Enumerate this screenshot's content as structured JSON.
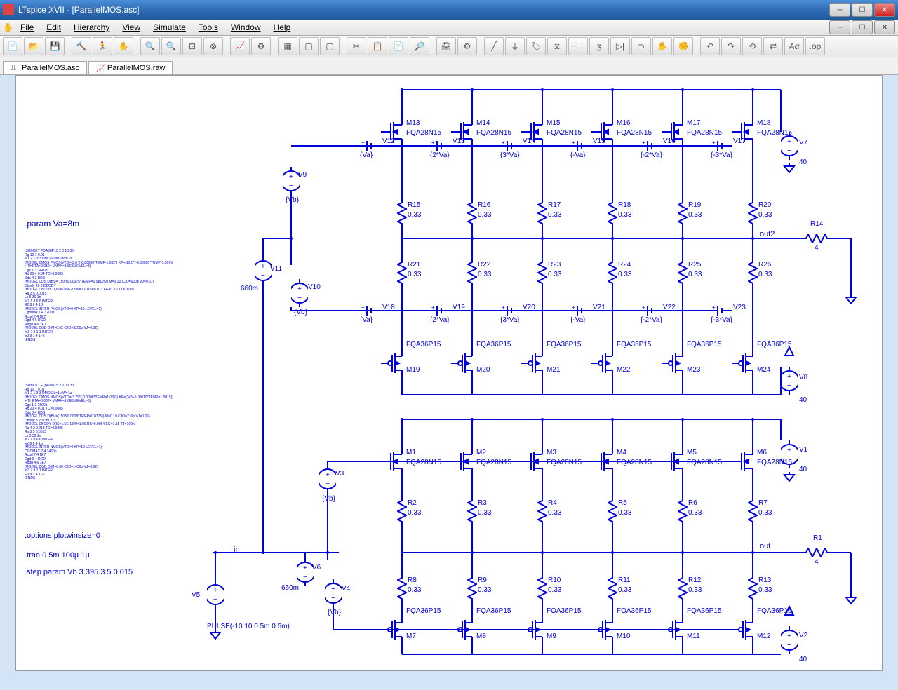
{
  "app_title": "LTspice XVII - [ParallelMOS.asc]",
  "menus": [
    "File",
    "Edit",
    "Hierarchy",
    "View",
    "Simulate",
    "Tools",
    "Window",
    "Help"
  ],
  "tabs": [
    "ParallelMOS.asc",
    "ParallelMOS.raw"
  ],
  "param_line": ".param Va=8m",
  "options_line": ".options plotwinsize=0",
  "tran_line": ".tran 0 5m 100µ 1µ",
  "step_line": ".step param Vb 3.395 3.5 0.015",
  "pulse_line": "PULSE(-10 10 0 5m 0 5m)",
  "in_label": "in",
  "out_label": "out",
  "out2_label": "out2",
  "components": {
    "V1": {
      "label": "V1",
      "value": "40"
    },
    "V2": {
      "label": "V2",
      "value": "40"
    },
    "V3": {
      "label": "V3",
      "value": "{Vb}"
    },
    "V4": {
      "label": "V4",
      "value": "{Vb}"
    },
    "V5": {
      "label": "V5",
      "value": ""
    },
    "V6": {
      "label": "V6",
      "value": "660m"
    },
    "V7": {
      "label": "V7",
      "value": "40"
    },
    "V8": {
      "label": "V8",
      "value": "40"
    },
    "V9": {
      "label": "V9",
      "value": "{Vb}"
    },
    "V10": {
      "label": "V10",
      "value": "{Vb}"
    },
    "V11": {
      "label": "V11",
      "value": "660m"
    },
    "V12": {
      "label": "V12",
      "value": "{Va}"
    },
    "V13": {
      "label": "V13",
      "value": "{2*Va}"
    },
    "V14": {
      "label": "V14",
      "value": "{3*Va}"
    },
    "V15": {
      "label": "V15",
      "value": "{-Va}"
    },
    "V16": {
      "label": "V16",
      "value": "{-2*Va}"
    },
    "V17": {
      "label": "V17",
      "value": "{-3*Va}"
    },
    "V18": {
      "label": "V18",
      "value": "{Va}"
    },
    "V19": {
      "label": "V19",
      "value": "{2*Va}"
    },
    "V20": {
      "label": "V20",
      "value": "{3*Va}"
    },
    "V21": {
      "label": "V21",
      "value": "{-Va}"
    },
    "V22": {
      "label": "V22",
      "value": "{-2*Va}"
    },
    "V23": {
      "label": "V23",
      "value": "{-3*Va}"
    },
    "R1": {
      "label": "R1",
      "value": "4"
    },
    "R2": {
      "label": "R2",
      "value": "0.33"
    },
    "R3": {
      "label": "R3",
      "value": "0.33"
    },
    "R4": {
      "label": "R4",
      "value": "0.33"
    },
    "R5": {
      "label": "R5",
      "value": "0.33"
    },
    "R6": {
      "label": "R6",
      "value": "0.33"
    },
    "R7": {
      "label": "R7",
      "value": "0.33"
    },
    "R8": {
      "label": "R8",
      "value": "0.33"
    },
    "R9": {
      "label": "R9",
      "value": "0.33"
    },
    "R10": {
      "label": "R10",
      "value": "0.33"
    },
    "R11": {
      "label": "R11",
      "value": "0.33"
    },
    "R12": {
      "label": "R12",
      "value": "0.33"
    },
    "R13": {
      "label": "R13",
      "value": "0.33"
    },
    "R14": {
      "label": "R14",
      "value": "4"
    },
    "R15": {
      "label": "R15",
      "value": "0.33"
    },
    "R16": {
      "label": "R16",
      "value": "0.33"
    },
    "R17": {
      "label": "R17",
      "value": "0.33"
    },
    "R18": {
      "label": "R18",
      "value": "0.33"
    },
    "R19": {
      "label": "R19",
      "value": "0.33"
    },
    "R20": {
      "label": "R20",
      "value": "0.33"
    },
    "R21": {
      "label": "R21",
      "value": "0.33"
    },
    "R22": {
      "label": "R22",
      "value": "0.33"
    },
    "R23": {
      "label": "R23",
      "value": "0.33"
    },
    "R24": {
      "label": "R24",
      "value": "0.33"
    },
    "R25": {
      "label": "R25",
      "value": "0.33"
    },
    "R26": {
      "label": "R26",
      "value": "0.33"
    },
    "M1": {
      "label": "M1",
      "value": "FQA28N15"
    },
    "M2": {
      "label": "M2",
      "value": "FQA28N15"
    },
    "M3": {
      "label": "M3",
      "value": "FQA28N15"
    },
    "M4": {
      "label": "M4",
      "value": "FQA28N15"
    },
    "M5": {
      "label": "M5",
      "value": "FQA28N15"
    },
    "M6": {
      "label": "M6",
      "value": "FQA28N15"
    },
    "M7": {
      "label": "M7",
      "value": "FQA36P15"
    },
    "M8": {
      "label": "M8",
      "value": "FQA36P15"
    },
    "M9": {
      "label": "M9",
      "value": "FQA36P15"
    },
    "M10": {
      "label": "M10",
      "value": "FQA36P15"
    },
    "M11": {
      "label": "M11",
      "value": "FQA36P15"
    },
    "M12": {
      "label": "M12",
      "value": "FQA36P15"
    },
    "M13": {
      "label": "M13",
      "value": "FQA28N15"
    },
    "M14": {
      "label": "M14",
      "value": "FQA28N15"
    },
    "M15": {
      "label": "M15",
      "value": "FQA28N15"
    },
    "M16": {
      "label": "M16",
      "value": "FQA28N15"
    },
    "M17": {
      "label": "M17",
      "value": "FQA28N15"
    },
    "M18": {
      "label": "M18",
      "value": "FQA28N15"
    },
    "M19": {
      "label": "M19",
      "value": "FQA36P15"
    },
    "M20": {
      "label": "M20",
      "value": "FQA36P15"
    },
    "M21": {
      "label": "M21",
      "value": "FQA36P15"
    },
    "M22": {
      "label": "M22",
      "value": "FQA36P15"
    },
    "M23": {
      "label": "M23",
      "value": "FQA36P15"
    },
    "M24": {
      "label": "M24",
      "value": "FQA36P15"
    }
  },
  "model_text_1": ".SUBCKT FQA36P15 2 0 10 30\nRg 10 1 0.01\nM1 2 1 3 3 DMOS L=1u W=1u\n.MODEL DMOS PMOS(VTO=-3.6 \\(-0.00080*TEMP-1.032)) KP=(19.5*(-0.00020*TEMP-1.007))\n+ THETA=0.0124 VMAX=1.5E5 LEVEL=3)\nCgs 1 3 3440p\nRd 20 4 0.04 TC=0.0085\nDds 4 3 DDS\n.MODEL DDS D(BV=(150*(0.00075*TEMP=0.98125)) M=0.10 CJO=600p VJ=0.61)\nDbody 20 3 DBODY\n.MODEL DBODY D(IS=6.05E-13 N=1.0 RS=0.013 EG=1.10 TT=180n)\nRa 3 5 0.0015\nLs 5 30 1n\nM2 1 8 6 6 INTER\nE2 8 6 4 1 2\n.MODEL INTER PMOS(VTO=0 KP=10 LEVEL=1)\nCgdmax 7 4 3200p\nRcgd 7 4 1E7\nDgd 4 6 DGD\nRdgd 4 6 1E7\n.MODEL DGD D(M=0.62 CJO=3200p VJ=0.52)\nM3 7 9 1 1 INTER\nE3 9 1 4 1 -2\n.ENDS",
  "model_text_2": ".SUBCKT FQA28N15 2 0 10 30\nRg 10 1 0.01\nM1 2 1 3 3 DMOS L=1u W=1u\n.MODEL DMOS NMOS(VTO=(3.79*(-0.0008*TEMP=1.032)) KP=(34*(-0.00010*TEMP=1.0015))\n+ THETA=0.0074 VMAX=1.6E5 LEVEL=3)\nCgs 1 3 1800p\nRd 20 4 0.01 TC=0.0085\nDds 3 4 DDS\n.MODEL DDS D(BV=(150*(0.0008*TEMP=0.0775)) M=0.10 CJO=216p VJ=0.66)\nDbody 3 20 DBODY\n.MODEL DBODY D(IS=1.5E-13 N=1.00 RS=0.0054 EG=1.15 TT=100n)\nRa 4 2 0.013 TC=0.0085\nRs 3 5 0.0015\nLs 5 30 1n\nM2 1 8 6 6 INTER\nE2 8 6 4 1 2\n.MODEL INTER NMOS(VTO=0 KP=10 LEVEL=1)\nCGDMAX 7 4 1450p\nRcgd 7 4 1E7\nDgd 6 4 DGD\nRdgd 4 6 1E7\n.MODEL DGD D(M=0.60 CJO=1450p VJ=0.62)\nM3 7 9 1 1 INTER\nE3 9 1 4 1 -2\n.ENDS"
}
